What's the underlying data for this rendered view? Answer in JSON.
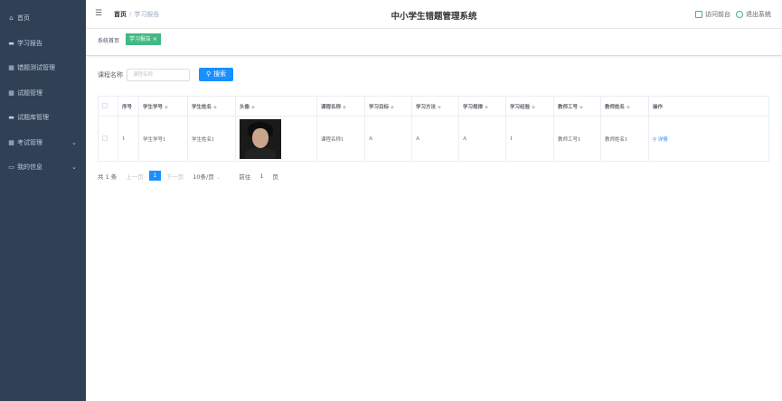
{
  "sidebar": {
    "items": [
      {
        "icon": "home-icon",
        "glyph": "⌂",
        "label": "首页"
      },
      {
        "icon": "briefcase-icon",
        "glyph": "▬",
        "label": "学习报告"
      },
      {
        "icon": "grid-icon",
        "glyph": "▦",
        "label": "错题测试管理"
      },
      {
        "icon": "grid-icon",
        "glyph": "▦",
        "label": "试题管理"
      },
      {
        "icon": "chat-icon",
        "glyph": "▬",
        "label": "试题库管理"
      },
      {
        "icon": "grid-icon",
        "glyph": "▦",
        "label": "考试管理",
        "arrow": "⌄"
      },
      {
        "icon": "folder-icon",
        "glyph": "▭",
        "label": "我的信息",
        "arrow": "⌄"
      }
    ]
  },
  "header": {
    "breadcrumb_home": "首页",
    "breadcrumb_sep": "/",
    "breadcrumb_current": "学习报告",
    "title": "中小学生错题管理系统",
    "visit_front": "访问前台",
    "logout": "退出系统"
  },
  "tags": {
    "home": "系统首页",
    "active": "学习报告 ×"
  },
  "search": {
    "label": "课程名称",
    "placeholder": "课程名称",
    "button": "搜索"
  },
  "table": {
    "headers": [
      "序号",
      "学生学号",
      "学生姓名",
      "头像",
      "课程名称",
      "学习目标",
      "学习方法",
      "学习规律",
      "学习经验",
      "教师工号",
      "教师姓名",
      "操作"
    ],
    "rows": [
      {
        "index": "1",
        "student_no": "学生学号1",
        "student_name": "学生姓名1",
        "course": "课程名称1",
        "goal": "A",
        "method": "A",
        "pattern": "A",
        "experience": "1",
        "teacher_no": "教师工号1",
        "teacher_name": "教师姓名1",
        "action": "详情"
      }
    ]
  },
  "pager": {
    "total": "共 1 条",
    "prev": "上一页",
    "page": "1",
    "next": "下一页",
    "size": "10条/页",
    "size_arrow": "⌄",
    "goto": "前往",
    "goto_value": "1",
    "page_unit": "页"
  },
  "colors": {
    "sidebar_bg": "#304156",
    "accent": "#1890ff",
    "tag_active": "#42b983"
  }
}
